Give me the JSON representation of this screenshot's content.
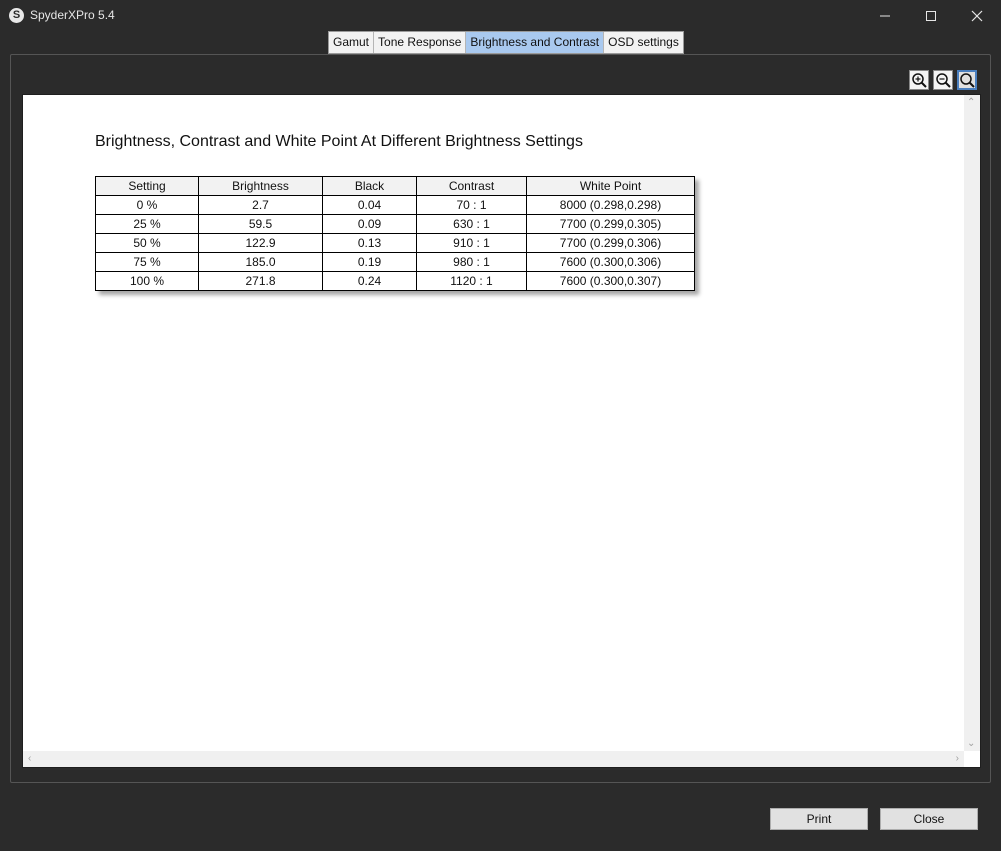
{
  "window": {
    "title": "SpyderXPro 5.4",
    "app_icon_glyph": "S"
  },
  "tabs": [
    {
      "label": "Gamut",
      "active": false
    },
    {
      "label": "Tone Response",
      "active": false
    },
    {
      "label": "Brightness and Contrast",
      "active": true
    },
    {
      "label": "OSD settings",
      "active": false
    }
  ],
  "zoom_tools": [
    "zoom-in-icon",
    "zoom-out-icon",
    "zoom-fit-icon"
  ],
  "report": {
    "title": "Brightness, Contrast and White Point At Different Brightness Settings",
    "columns": [
      "Setting",
      "Brightness",
      "Black",
      "Contrast",
      "White Point"
    ],
    "rows": [
      [
        "0 %",
        "2.7",
        "0.04",
        "70 : 1",
        "8000 (0.298,0.298)"
      ],
      [
        "25 %",
        "59.5",
        "0.09",
        "630 : 1",
        "7700 (0.299,0.305)"
      ],
      [
        "50 %",
        "122.9",
        "0.13",
        "910 : 1",
        "7700 (0.299,0.306)"
      ],
      [
        "75 %",
        "185.0",
        "0.19",
        "980 : 1",
        "7600 (0.300,0.306)"
      ],
      [
        "100 %",
        "271.8",
        "0.24",
        "1120 : 1",
        "7600 (0.300,0.307)"
      ]
    ]
  },
  "buttons": {
    "print": "Print",
    "close": "Close"
  },
  "colors": {
    "active_tab": "#a9c9ef",
    "background": "#2b2b2b"
  }
}
